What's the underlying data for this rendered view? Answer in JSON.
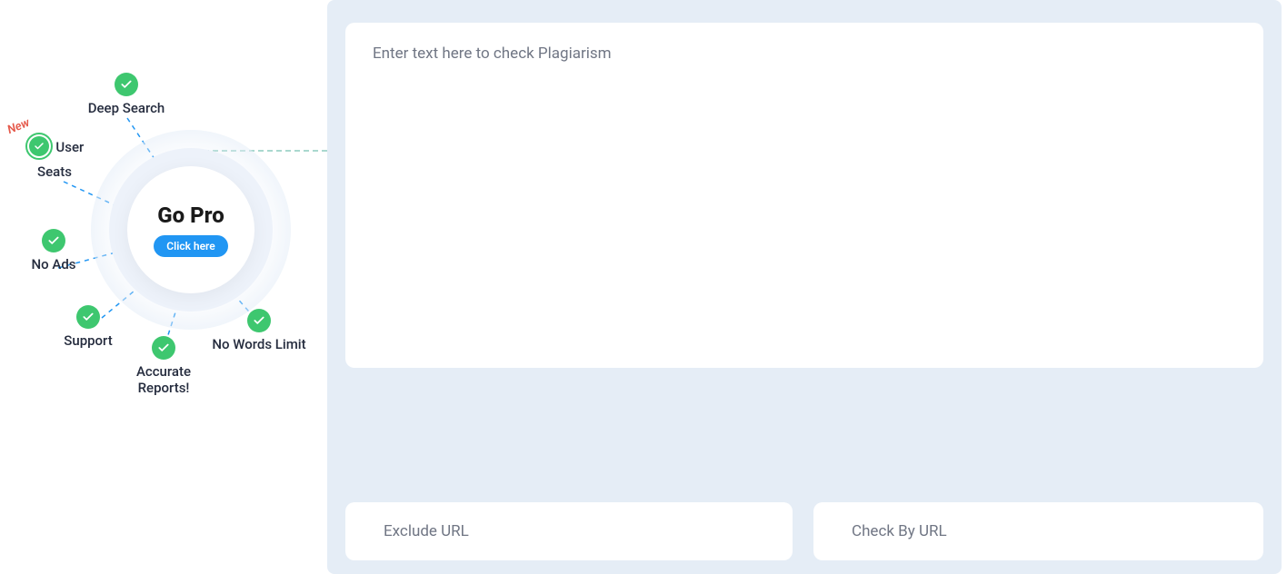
{
  "go_pro": {
    "title": "Go Pro",
    "button_label": "Click here",
    "new_badge": "New",
    "features": {
      "deep_search": "Deep Search",
      "user_seats": "User Seats",
      "no_ads": "No Ads",
      "support": "Support",
      "accurate_reports": "Accurate Reports!",
      "no_words_limit": "No Words Limit"
    }
  },
  "main": {
    "textarea_placeholder": "Enter text here to check Plagiarism",
    "exclude_url_placeholder": "Exclude URL",
    "check_by_url_placeholder": "Check By URL"
  },
  "colors": {
    "panel_bg": "#E5EDF6",
    "accent_green": "#3EC76F",
    "accent_blue": "#2196F3",
    "new_badge": "#E5584A"
  }
}
